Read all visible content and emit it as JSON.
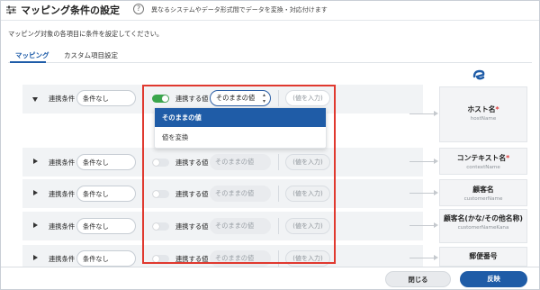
{
  "header": {
    "title": "マッピング条件の設定",
    "help_symbol": "?",
    "description": "異なるシステムやデータ形式間でデータを変換・対応付けます"
  },
  "instruction": "マッピング対象の各項目に条件を設定してください。",
  "tabs": [
    {
      "label": "マッピング",
      "active": true
    },
    {
      "label": "カスタム項目設定",
      "active": false
    }
  ],
  "labels": {
    "condition": "連携条件",
    "linked_value": "連携する値"
  },
  "rows": [
    {
      "expanded": true,
      "condition": "条件なし",
      "toggle_on": true,
      "value_mode": "そのままの値",
      "value_input": "(値を入力)",
      "target_name": "ホスト名",
      "target_key": "hostName",
      "required": true
    },
    {
      "expanded": false,
      "condition": "条件なし",
      "toggle_on": false,
      "value_mode": "そのままの値",
      "value_input": "(値を入力)",
      "target_name": "コンテキスト名",
      "target_key": "contextName",
      "required": true
    },
    {
      "expanded": false,
      "condition": "条件なし",
      "toggle_on": false,
      "value_mode": "そのままの値",
      "value_input": "(値を入力)",
      "target_name": "顧客名",
      "target_key": "customerName",
      "required": false
    },
    {
      "expanded": false,
      "condition": "条件なし",
      "toggle_on": false,
      "value_mode": "そのままの値",
      "value_input": "(値を入力)",
      "target_name": "顧客名(かな/その他名称)",
      "target_key": "customerNameKana",
      "required": false
    },
    {
      "expanded": false,
      "condition": "条件なし",
      "toggle_on": false,
      "value_mode": "そのままの値",
      "value_input": "(値を入力)",
      "target_name": "郵便番号",
      "target_key": "",
      "required": false
    }
  ],
  "required_mark": "*",
  "dropdown": {
    "options": [
      "そのままの値",
      "値を変換"
    ],
    "selected": "そのままの値"
  },
  "footer": {
    "close_label": "閉じる",
    "apply_label": "反映"
  },
  "colors": {
    "accent": "#1f5ca7",
    "toggle_on": "#3aa64c",
    "highlight_box": "#e0392f",
    "required": "#e03c3c"
  }
}
